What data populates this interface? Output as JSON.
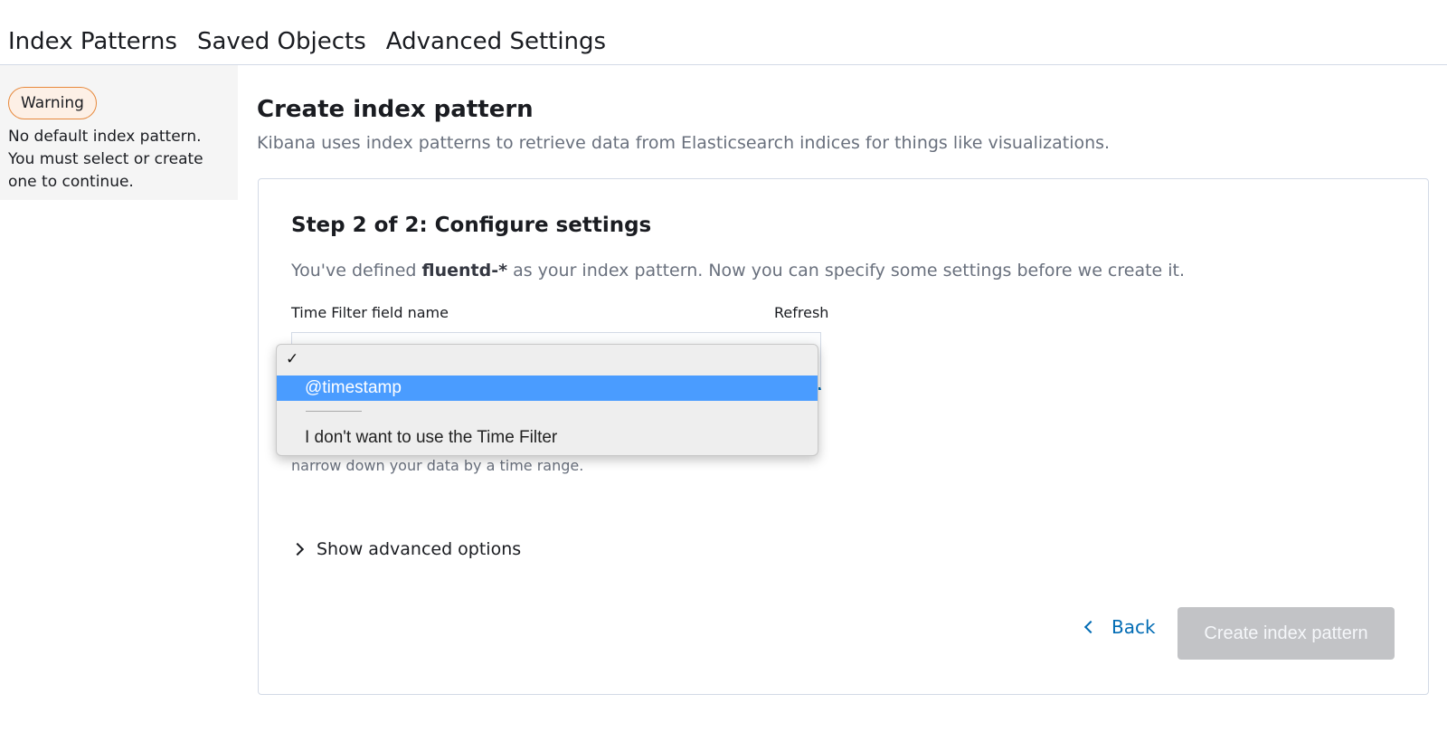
{
  "top_link_fragment": "…",
  "tabs": [
    {
      "label": "Index Patterns"
    },
    {
      "label": "Saved Objects"
    },
    {
      "label": "Advanced Settings"
    }
  ],
  "sidebar": {
    "warning_badge": "Warning",
    "warning_text": "No default index pattern. You must select or create one to continue."
  },
  "main": {
    "title": "Create index pattern",
    "description": "Kibana uses index patterns to retrieve data from Elasticsearch indices for things like visualizations."
  },
  "step": {
    "title": "Step 2 of 2: Configure settings",
    "desc_prefix": "You've defined",
    "pattern": "fluentd-*",
    "desc_suffix": "as your index pattern. Now you can specify some settings before we create it.",
    "field_label": "Time Filter field name",
    "refresh_label": "Refresh",
    "help_text": "narrow down your data by a time range.",
    "advanced_label": "Show advanced options",
    "back_label": "Back",
    "create_label": "Create index pattern"
  },
  "dropdown": {
    "check_mark": "✓",
    "options": [
      {
        "label": "@timestamp",
        "highlighted": true
      },
      {
        "label": "I don't want to use the Time Filter",
        "highlighted": false
      }
    ]
  },
  "colors": {
    "link": "#006bb4",
    "warning_border": "#e7893c",
    "highlight": "#4a9cff",
    "disabled_button": "#c2c3c6"
  }
}
